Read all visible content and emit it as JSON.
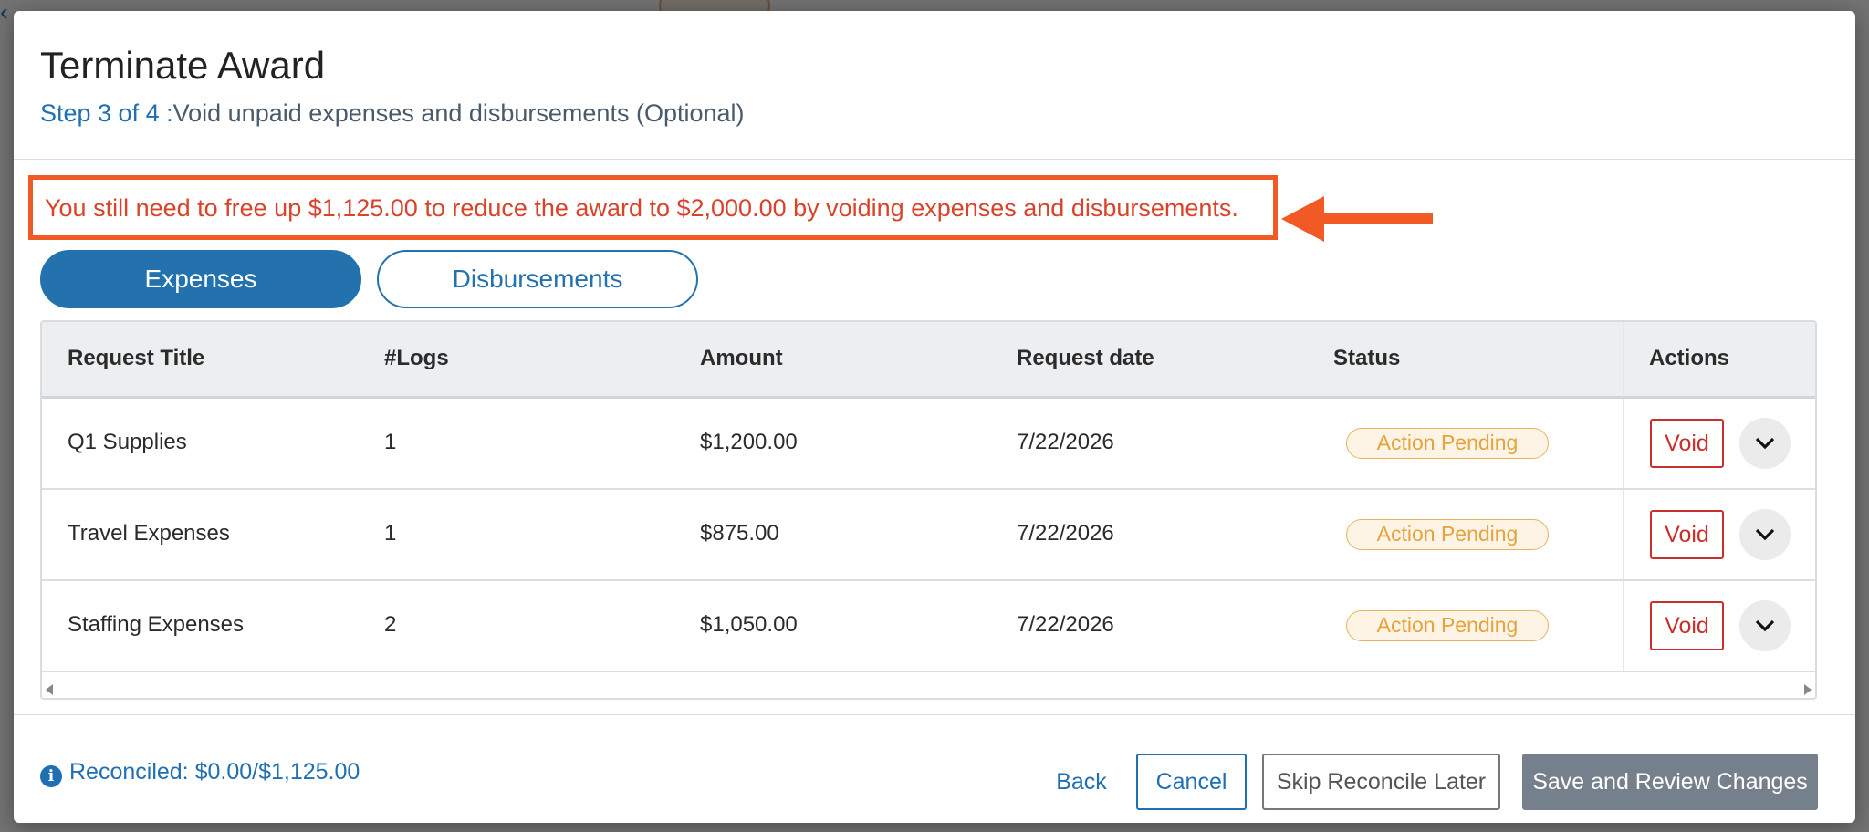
{
  "modal": {
    "title": "Terminate Award",
    "step_label": "Step 3 of 4 :",
    "step_description": "Void unpaid expenses and disbursements (Optional)"
  },
  "alert": {
    "message": "You still need to free up $1,125.00 to reduce the award to $2,000.00 by voiding expenses and disbursements.",
    "highlight_color": "#f15a24"
  },
  "tabs": [
    {
      "label": "Expenses",
      "active": true
    },
    {
      "label": "Disbursements",
      "active": false
    }
  ],
  "table": {
    "columns": [
      "Request Title",
      "#Logs",
      "Amount",
      "Request date",
      "Status",
      "Actions"
    ],
    "rows": [
      {
        "title": "Q1 Supplies",
        "logs": "1",
        "amount": "$1,200.00",
        "date": "7/22/2026",
        "status": "Action Pending",
        "action": "Void"
      },
      {
        "title": "Travel Expenses",
        "logs": "1",
        "amount": "$875.00",
        "date": "7/22/2026",
        "status": "Action Pending",
        "action": "Void"
      },
      {
        "title": "Staffing Expenses",
        "logs": "2",
        "amount": "$1,050.00",
        "date": "7/22/2026",
        "status": "Action Pending",
        "action": "Void"
      }
    ]
  },
  "footer": {
    "reconciled": "Reconciled: $0.00/$1,125.00",
    "info_icon": "info-icon",
    "back_label": "Back",
    "cancel_label": "Cancel",
    "skip_label": "Skip Reconcile Later",
    "save_label": "Save and Review Changes"
  },
  "colors": {
    "primary": "#2372ad",
    "danger": "#c9302c",
    "warning": "#e6a23c",
    "alert_text": "#d8432a"
  }
}
